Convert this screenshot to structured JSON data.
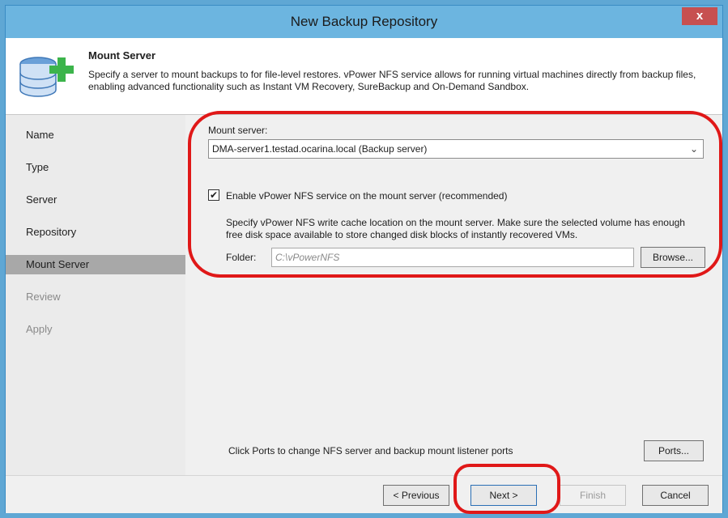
{
  "window": {
    "title": "New Backup Repository",
    "close_label": "x"
  },
  "header": {
    "title": "Mount Server",
    "description": "Specify a server to mount backups to for file-level restores. vPower NFS service allows for running virtual machines directly from backup files, enabling advanced functionality such as Instant VM Recovery, SureBackup and On-Demand Sandbox."
  },
  "sidebar": {
    "items": [
      {
        "label": "Name"
      },
      {
        "label": "Type"
      },
      {
        "label": "Server"
      },
      {
        "label": "Repository"
      },
      {
        "label": "Mount Server"
      },
      {
        "label": "Review"
      },
      {
        "label": "Apply"
      }
    ],
    "active_index": 4
  },
  "form": {
    "mount_server_label": "Mount server:",
    "mount_server_value": "DMA-server1.testad.ocarina.local (Backup server)",
    "enable_nfs_label": "Enable vPower NFS service on the mount server (recommended)",
    "enable_nfs_checked": true,
    "nfs_description": "Specify vPower NFS write cache location on the mount server. Make sure the selected volume has enough free disk space available to store changed disk blocks of instantly recovered VMs.",
    "folder_label": "Folder:",
    "folder_value": "C:\\vPowerNFS",
    "browse_label": "Browse...",
    "ports_text": "Click Ports to change NFS server and backup mount listener ports",
    "ports_label": "Ports..."
  },
  "footer": {
    "previous_label": "< Previous",
    "next_label": "Next >",
    "finish_label": "Finish",
    "cancel_label": "Cancel"
  },
  "colors": {
    "highlight": "#e01818",
    "titlebar": "#6cb5e0",
    "close": "#c75050"
  }
}
